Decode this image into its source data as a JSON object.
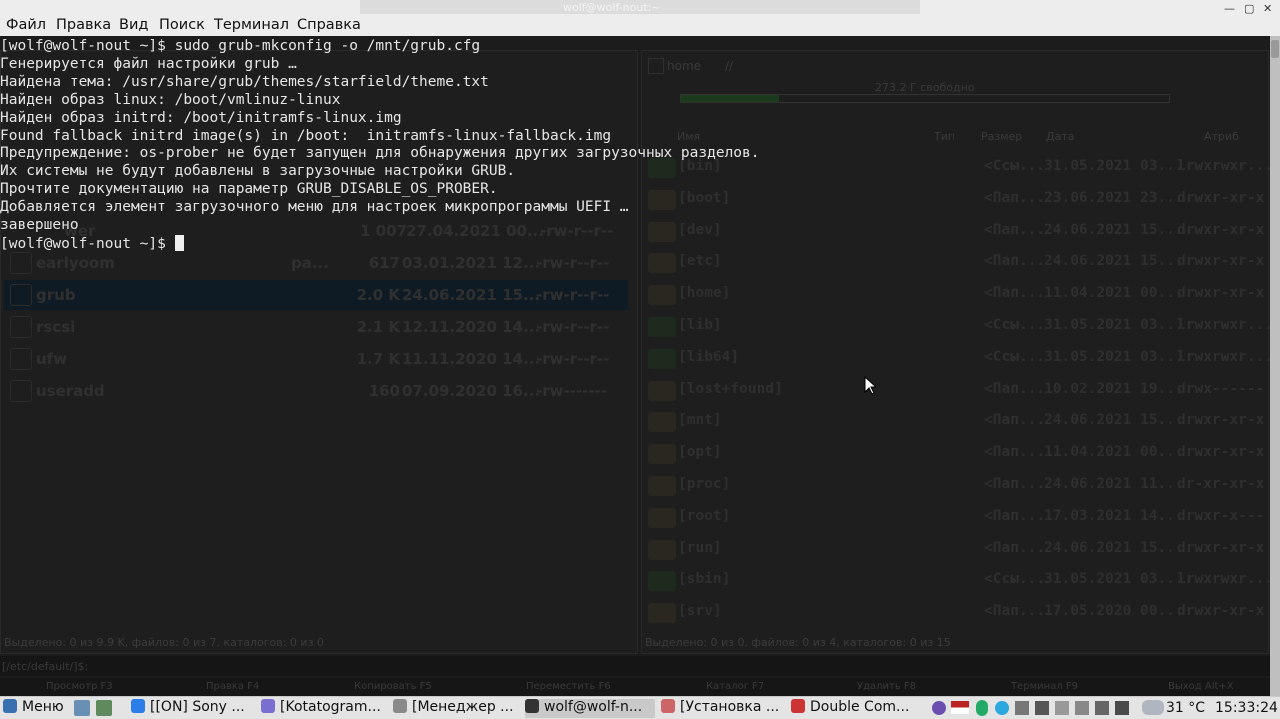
{
  "menubar": {
    "items": [
      "Файл",
      "Правка",
      "Вид",
      "Поиск",
      "Терминал",
      "Справка"
    ]
  },
  "window": {
    "title": "wolf@wolf-nout:~"
  },
  "terminal": {
    "lines": [
      "[wolf@wolf-nout ~]$ sudo grub-mkconfig -o /mnt/grub.cfg",
      "Генерируется файл настройки grub …",
      "Найдена тема: /usr/share/grub/themes/starfield/theme.txt",
      "Найден образ linux: /boot/vmlinuz-linux",
      "Найден образ initrd: /boot/initramfs-linux.img",
      "Found fallback initrd image(s) in /boot:  initramfs-linux-fallback.img",
      "Предупреждение: os-prober не будет запущен для обнаружения других загрузочных разделов.",
      "Их системы не будут добавлены в загрузочные настройки GRUB.",
      "Прочтите документацию на параметр GRUB_DISABLE_OS_PROBER.",
      "Добавляется элемент загрузочного меню для настроек микропрограммы UEFI …",
      "завершено"
    ],
    "prompt": "[wolf@wolf-nout ~]$ "
  },
  "left_panel": {
    "rows": [
      {
        "name": "earlyoom",
        "ext": "pa...",
        "size": "617",
        "date": "03.01.2021 12...",
        "attr": "-rw-r--r--"
      },
      {
        "name": "grub",
        "ext": "",
        "size": "2.0 K",
        "date": "24.06.2021 15...",
        "attr": "-rw-r--r--"
      },
      {
        "name": "rscsi",
        "ext": "",
        "size": "2.1 K",
        "date": "12.11.2020 14...",
        "attr": "-rw-r--r--"
      },
      {
        "name": "ufw",
        "ext": "",
        "size": "1.7 K",
        "date": "11.11.2020 14...",
        "attr": "-rw-r--r--"
      },
      {
        "name": "useradd",
        "ext": "",
        "size": "160",
        "date": "07.09.2020 16...",
        "attr": "-rw-------"
      }
    ],
    "partial_size": "1 007",
    "partial_date": "27.04.2021 00...",
    "partial_attr": "-rw-r--r--",
    "partial_name": "wer",
    "status": "Выделено: 0 из 9.9 K, файлов: 0 из 7, каталогов: 0 из 0"
  },
  "right_panel": {
    "path_home": "home",
    "path_root": "//",
    "free": "273.2 Г свободно",
    "free_fraction": 0.2,
    "headers": {
      "name": "Имя",
      "type": "Тип",
      "size": "Размер",
      "date": "Дата",
      "attr": "Атриб"
    },
    "rows": [
      {
        "name": "[bin]",
        "size": "<Ссы...",
        "date": "31.05.2021 03...",
        "attr": "lrwxrwxr...",
        "link": true
      },
      {
        "name": "[boot]",
        "size": "<Пап...",
        "date": "23.06.2021 23...",
        "attr": "drwxr-xr-x",
        "link": false
      },
      {
        "name": "[dev]",
        "size": "<Пап...",
        "date": "24.06.2021 15...",
        "attr": "drwxr-xr-x",
        "link": false
      },
      {
        "name": "[etc]",
        "size": "<Пап...",
        "date": "24.06.2021 15...",
        "attr": "drwxr-xr-x",
        "link": false
      },
      {
        "name": "[home]",
        "size": "<Пап...",
        "date": "11.04.2021 00...",
        "attr": "drwxr-xr-x",
        "link": false
      },
      {
        "name": "[lib]",
        "size": "<Ссы...",
        "date": "31.05.2021 03...",
        "attr": "lrwxrwxr...",
        "link": true
      },
      {
        "name": "[lib64]",
        "size": "<Ссы...",
        "date": "31.05.2021 03...",
        "attr": "lrwxrwxr...",
        "link": true
      },
      {
        "name": "[lost+found]",
        "size": "<Пап...",
        "date": "10.02.2021 19...",
        "attr": "drwx------",
        "link": false
      },
      {
        "name": "[mnt]",
        "size": "<Пап...",
        "date": "24.06.2021 15...",
        "attr": "drwxr-xr-x",
        "link": false
      },
      {
        "name": "[opt]",
        "size": "<Пап...",
        "date": "11.04.2021 00...",
        "attr": "drwxr-xr-x",
        "link": false
      },
      {
        "name": "[proc]",
        "size": "<Пап...",
        "date": "24.06.2021 11...",
        "attr": "dr-xr-xr-x",
        "link": false
      },
      {
        "name": "[root]",
        "size": "<Пап...",
        "date": "17.03.2021 14...",
        "attr": "drwxr-x---",
        "link": false
      },
      {
        "name": "[run]",
        "size": "<Пап...",
        "date": "24.06.2021 15...",
        "attr": "drwxr-xr-x",
        "link": false
      },
      {
        "name": "[sbin]",
        "size": "<Ссы...",
        "date": "31.05.2021 03...",
        "attr": "lrwxrwxr...",
        "link": true
      },
      {
        "name": "[srv]",
        "size": "<Пап...",
        "date": "17.05.2020 00...",
        "attr": "drwxr-xr-x",
        "link": false
      }
    ],
    "status": "Выделено: 0 из 0, файлов: 0 из 4, каталогов: 0 из 15"
  },
  "cmdline": {
    "path": "[/etc/default/]$:"
  },
  "fkeys": [
    "Просмотр F3",
    "Правка F4",
    "Копировать F5",
    "Переместить F6",
    "Каталог F7",
    "Удалить F8",
    "Терминал F9",
    "Выход Alt+X"
  ],
  "taskbar": {
    "menu": "Меню",
    "tasks": [
      "[[ON] Sony ...",
      "[Kotatogram...",
      "[Менеджер ...",
      "wolf@wolf-n...",
      "[Установка ...",
      "Double Com..."
    ],
    "temp": "31 °C",
    "time": "15:33:24"
  }
}
